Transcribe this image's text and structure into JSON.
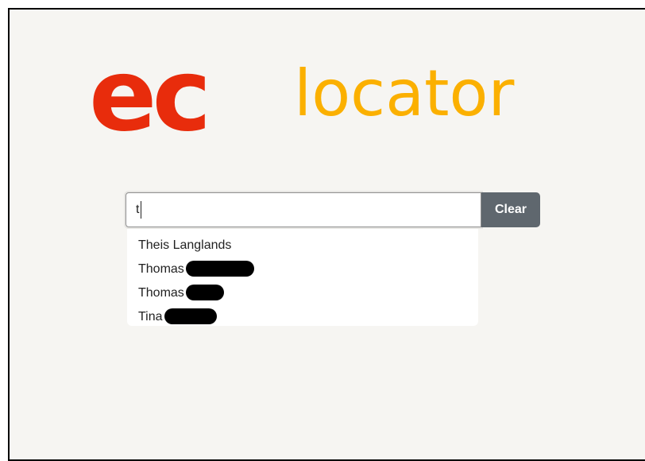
{
  "logo": {
    "ec_text": "ec",
    "locator_text": "locator",
    "ec_color": "#e82c0c",
    "locator_color": "#fbb000"
  },
  "search": {
    "value": "t",
    "clear_label": "Clear"
  },
  "suggestions": [
    {
      "text": "Theis Langlands",
      "redacted": false
    },
    {
      "text": "Thomas",
      "redacted": true
    },
    {
      "text": "Thomas",
      "redacted": true
    },
    {
      "text": "Tina",
      "redacted": true
    }
  ],
  "colors": {
    "background": "#f6f5f2",
    "clear_button": "#5f676e"
  }
}
